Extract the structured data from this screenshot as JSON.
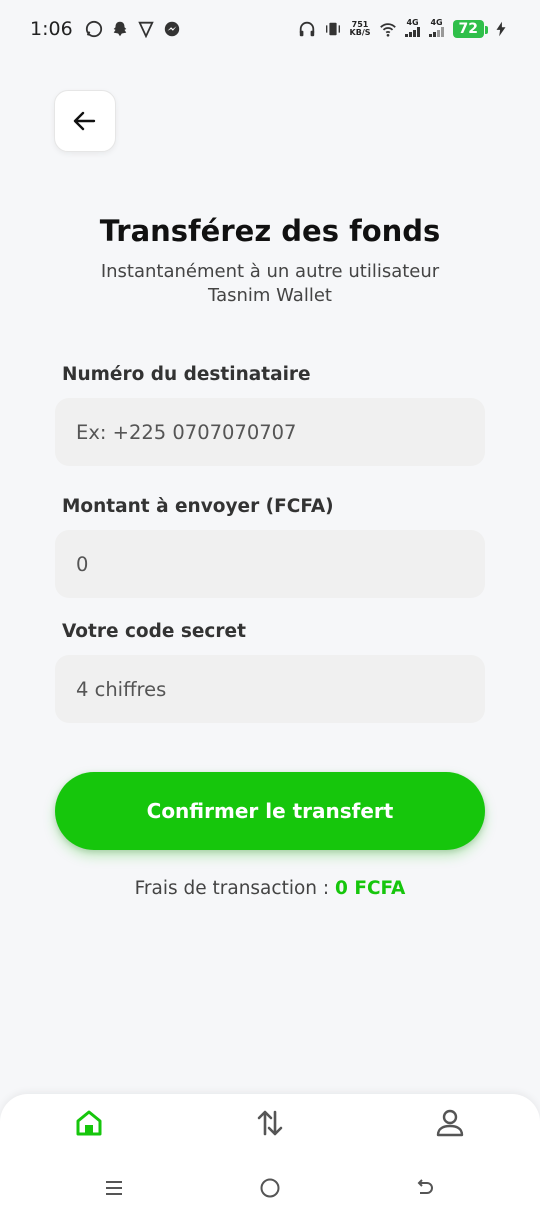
{
  "status_bar": {
    "time": "1:06",
    "net_speed_value": "751",
    "net_speed_unit": "KB/S",
    "signal1": "4G",
    "signal2": "4G",
    "battery": "72"
  },
  "header": {
    "title": "Transférez des fonds",
    "subtitle": "Instantanément à un autre utilisateur Tasnim Wallet"
  },
  "form": {
    "recipient_label": "Numéro du destinataire",
    "recipient_placeholder": "Ex: +225 0707070707",
    "amount_label": "Montant à envoyer (FCFA)",
    "amount_value": "0",
    "code_label": "Votre code secret",
    "code_placeholder": "4 chiffres"
  },
  "confirm_label": "Confirmer le transfert",
  "fees": {
    "label": "Frais de transaction :",
    "amount": "0 FCFA"
  },
  "colors": {
    "accent": "#16c60c",
    "background": "#f6f7f9",
    "field": "#f0f0f0"
  },
  "icons": {
    "back": "arrow-left-icon",
    "nav_home": "home-icon",
    "nav_transfer": "transfer-arrows-icon",
    "nav_profile": "user-icon"
  }
}
